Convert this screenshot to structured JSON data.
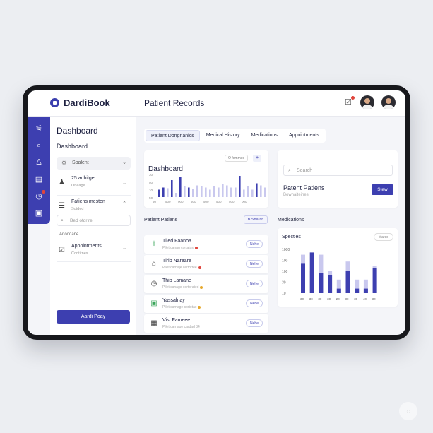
{
  "app": {
    "name": "DardiBook",
    "page_title": "Patient Records"
  },
  "header": {
    "notification_icon": "clipboard-check-icon",
    "avatars": [
      "user-avatar-1",
      "user-avatar-2"
    ]
  },
  "rail": {
    "icons": [
      "sliders-icon",
      "search-icon",
      "user-icon",
      "folder-icon",
      "clock-icon",
      "document-icon"
    ]
  },
  "sidebar": {
    "title": "Dashboard",
    "subtitle": "Dashboard",
    "select": {
      "label": "Spalent"
    },
    "rows": [
      {
        "title": "25 adhitge",
        "subtitle": "Oneage"
      },
      {
        "title": "Fatiens mesten",
        "subtitle": "Sotded"
      }
    ],
    "search": {
      "placeholder": "Bed otdrire"
    },
    "label": "Anoodane",
    "appointments": {
      "title": "Appointments",
      "subtitle": "Contirnes"
    },
    "button_label": "Aardi Poay"
  },
  "tabs": [
    {
      "label": "Patient Dongnanics",
      "active": true
    },
    {
      "label": "Medical History",
      "active": false
    },
    {
      "label": "Medications",
      "active": false
    },
    {
      "label": "Appointments",
      "active": false
    }
  ],
  "dashboard_card": {
    "title": "Dashboard",
    "pill_label": "O femmes",
    "plus_label": "+",
    "chart_data": {
      "type": "bar",
      "y_ticks": [
        "30",
        "50",
        "10",
        "50"
      ],
      "x_ticks": [
        "50",
        "500",
        "000",
        "500",
        "500",
        "500",
        "500",
        "000"
      ],
      "values": [
        0.35,
        0.45,
        0.42,
        0.8,
        0.2,
        0.95,
        0.5,
        0.45,
        0.4,
        0.55,
        0.5,
        0.45,
        0.35,
        0.5,
        0.45,
        0.6,
        0.55,
        0.45,
        0.45,
        1.0,
        0.35,
        0.5,
        0.35,
        0.65,
        0.55,
        0.45
      ],
      "dark_bars": [
        0,
        1,
        3,
        5,
        7,
        19,
        23
      ]
    }
  },
  "search_card": {
    "search_placeholder": "Search",
    "title": "Patent Patiens",
    "subtitle": "Bownaiteines",
    "button_label": "Stew"
  },
  "patient_list": {
    "title": "Patient Patiens",
    "button_label": "B Snarch",
    "items": [
      {
        "icon": "stethoscope-icon",
        "name": "Tlied Faanoa",
        "info": "Pilet canag cortatos",
        "status_color": "#e0453c",
        "badge": "Nehe"
      },
      {
        "icon": "building-icon",
        "name": "Tlrip Nareare",
        "info": "Pilet carnaje certortee",
        "status_color": "#e0453c",
        "badge": "Nehe"
      },
      {
        "icon": "clock-icon",
        "name": "Thip Lamane",
        "info": "Pilet canage cortorated",
        "status_color": "#e6a82b",
        "badge": "Nehe"
      },
      {
        "icon": "monitor-icon",
        "name": "Yassalnay",
        "info": "Pilet carnage cortotac",
        "status_color": "#e6a82b",
        "badge": "Nehe"
      },
      {
        "icon": "grid-icon",
        "name": "Vist Fameee",
        "info": "Pilet carnage cardad 34",
        "status_color": "",
        "badge": "Nehe"
      }
    ]
  },
  "medications": {
    "label": "Medications",
    "card_title": "Specties",
    "pill_label": "Mared",
    "chart_data": {
      "type": "bar",
      "y_ticks": [
        "1000",
        "100",
        "100",
        "30",
        "10"
      ],
      "x_ticks": [
        "30",
        "30",
        "30",
        "30",
        "20",
        "30",
        "30",
        "40",
        "30"
      ],
      "ylim": [
        0,
        1
      ],
      "series": [
        {
          "values": [
            0.85,
            0.5,
            0.85,
            0.5,
            0.3,
            0.7,
            0.3,
            0.3,
            0.6
          ]
        },
        {
          "values": [
            0.65,
            0.9,
            0.45,
            0.4,
            0.1,
            0.5,
            0.1,
            0.1,
            0.55
          ]
        }
      ],
      "series_colors": [
        "#c9c8ee",
        "#3d3fb0"
      ]
    }
  },
  "corner_button_icon": "expand-icon"
}
